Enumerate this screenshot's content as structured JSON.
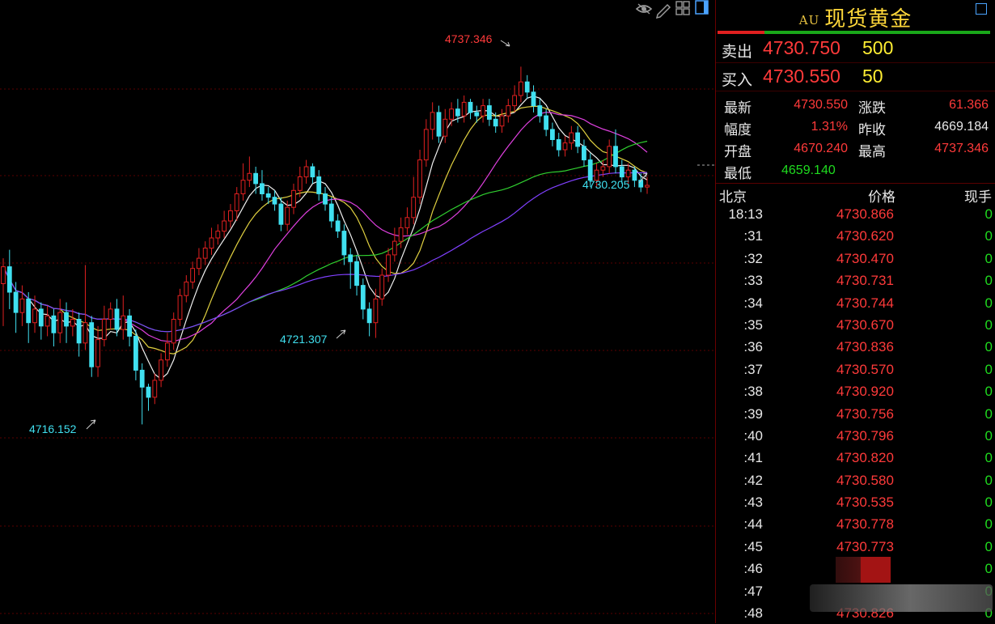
{
  "chart": {
    "toolbar_icons": [
      "eye-icon",
      "pencil-icon",
      "grid-icon",
      "panel-icon"
    ],
    "annotations": {
      "high": "4737.346",
      "low_mid": "4721.307",
      "low_left": "4716.152",
      "last": "4730.205"
    },
    "colors": {
      "up": "#e02020",
      "down": "#40e0f0",
      "ma5": "#f0f0f0",
      "ma10": "#e0d040",
      "ma20": "#e040e0",
      "ma40": "#30d030",
      "ma60": "#8040ff"
    }
  },
  "chart_data": {
    "type": "candlestick",
    "y_range": [
      4714.5,
      4739.8
    ],
    "hlines": [
      4737.346,
      4730.205,
      4716.152
    ],
    "candles": [
      [
        4724.5,
        4725.5,
        4722.0,
        4726.0
      ],
      [
        4725.5,
        4724.0,
        4723.0,
        4726.5
      ],
      [
        4724.0,
        4722.8,
        4721.6,
        4724.6
      ],
      [
        4722.8,
        4723.6,
        4722.0,
        4724.4
      ],
      [
        4723.6,
        4722.2,
        4721.0,
        4724.0
      ],
      [
        4722.2,
        4723.0,
        4721.6,
        4723.8
      ],
      [
        4723.0,
        4722.0,
        4721.2,
        4723.4
      ],
      [
        4722.0,
        4722.6,
        4721.4,
        4723.2
      ],
      [
        4722.6,
        4721.6,
        4720.8,
        4723.0
      ],
      [
        4721.6,
        4722.8,
        4721.0,
        4723.6
      ],
      [
        4722.8,
        4722.0,
        4721.0,
        4723.4
      ],
      [
        4722.0,
        4722.4,
        4721.4,
        4723.0
      ],
      [
        4722.4,
        4721.0,
        4720.2,
        4722.8
      ],
      [
        4721.0,
        4722.2,
        4720.6,
        4725.6
      ],
      [
        4722.2,
        4719.6,
        4719.0,
        4722.6
      ],
      [
        4719.6,
        4721.2,
        4719.0,
        4722.0
      ],
      [
        4721.2,
        4722.4,
        4720.8,
        4723.2
      ],
      [
        4722.4,
        4723.0,
        4721.8,
        4723.4
      ],
      [
        4723.0,
        4721.8,
        4721.4,
        4723.6
      ],
      [
        4721.8,
        4722.6,
        4721.2,
        4723.8
      ],
      [
        4722.6,
        4721.4,
        4720.8,
        4723.0
      ],
      [
        4721.4,
        4719.4,
        4718.8,
        4721.8
      ],
      [
        4719.4,
        4718.4,
        4716.2,
        4719.8
      ],
      [
        4718.4,
        4717.8,
        4717.0,
        4718.6
      ],
      [
        4717.8,
        4718.8,
        4717.4,
        4719.2
      ],
      [
        4718.8,
        4720.0,
        4718.4,
        4720.4
      ],
      [
        4720.0,
        4721.0,
        4719.6,
        4721.6
      ],
      [
        4721.0,
        4722.4,
        4720.6,
        4722.8
      ],
      [
        4722.4,
        4723.8,
        4722.0,
        4724.2
      ],
      [
        4723.8,
        4724.6,
        4723.4,
        4725.0
      ],
      [
        4724.6,
        4725.4,
        4724.2,
        4725.8
      ],
      [
        4725.4,
        4726.0,
        4725.0,
        4726.6
      ],
      [
        4726.0,
        4726.6,
        4725.6,
        4727.0
      ],
      [
        4726.6,
        4727.2,
        4726.2,
        4727.8
      ],
      [
        4727.2,
        4727.6,
        4726.8,
        4728.0
      ],
      [
        4727.6,
        4728.2,
        4727.2,
        4728.8
      ],
      [
        4728.2,
        4728.8,
        4727.8,
        4729.2
      ],
      [
        4728.8,
        4729.8,
        4728.2,
        4730.2
      ],
      [
        4729.8,
        4730.6,
        4729.4,
        4731.6
      ],
      [
        4730.6,
        4731.0,
        4730.2,
        4732.0
      ],
      [
        4731.0,
        4730.4,
        4729.8,
        4731.4
      ],
      [
        4730.4,
        4729.8,
        4729.4,
        4731.2
      ],
      [
        4729.8,
        4729.6,
        4729.2,
        4730.2
      ],
      [
        4729.6,
        4729.2,
        4728.8,
        4730.0
      ],
      [
        4729.2,
        4728.0,
        4727.6,
        4729.6
      ],
      [
        4728.0,
        4729.0,
        4727.6,
        4729.4
      ],
      [
        4729.0,
        4730.0,
        4728.6,
        4730.4
      ],
      [
        4730.0,
        4730.8,
        4729.6,
        4731.4
      ],
      [
        4730.8,
        4731.4,
        4730.4,
        4731.8
      ],
      [
        4731.4,
        4730.8,
        4730.4,
        4731.6
      ],
      [
        4730.8,
        4729.8,
        4729.4,
        4731.2
      ],
      [
        4729.8,
        4729.2,
        4728.8,
        4730.2
      ],
      [
        4729.2,
        4728.2,
        4727.8,
        4729.6
      ],
      [
        4728.2,
        4727.6,
        4727.2,
        4728.6
      ],
      [
        4727.6,
        4726.2,
        4725.6,
        4728.0
      ],
      [
        4726.2,
        4725.8,
        4724.2,
        4726.6
      ],
      [
        4725.8,
        4724.4,
        4723.8,
        4726.2
      ],
      [
        4724.4,
        4723.0,
        4722.4,
        4724.8
      ],
      [
        4723.0,
        4722.2,
        4721.4,
        4723.4
      ],
      [
        4722.2,
        4723.6,
        4721.3,
        4724.2
      ],
      [
        4723.6,
        4725.0,
        4723.2,
        4725.4
      ],
      [
        4725.0,
        4726.2,
        4724.6,
        4726.6
      ],
      [
        4726.2,
        4727.0,
        4725.8,
        4727.8
      ],
      [
        4727.0,
        4727.8,
        4726.6,
        4728.4
      ],
      [
        4727.8,
        4728.4,
        4727.4,
        4729.0
      ],
      [
        4728.4,
        4729.6,
        4728.0,
        4730.8
      ],
      [
        4729.6,
        4731.8,
        4729.2,
        4732.4
      ],
      [
        4731.8,
        4733.6,
        4731.4,
        4734.2
      ],
      [
        4733.6,
        4734.6,
        4733.0,
        4735.2
      ],
      [
        4734.6,
        4733.2,
        4732.8,
        4735.0
      ],
      [
        4733.2,
        4734.2,
        4732.8,
        4734.8
      ],
      [
        4734.2,
        4734.8,
        4733.8,
        4735.2
      ],
      [
        4734.8,
        4734.4,
        4734.0,
        4735.4
      ],
      [
        4734.4,
        4735.2,
        4734.0,
        4735.6
      ],
      [
        4735.2,
        4734.6,
        4734.2,
        4735.4
      ],
      [
        4734.6,
        4734.4,
        4734.0,
        4735.0
      ],
      [
        4734.4,
        4735.0,
        4734.0,
        4735.4
      ],
      [
        4735.0,
        4734.2,
        4733.8,
        4735.4
      ],
      [
        4734.2,
        4733.8,
        4733.4,
        4734.6
      ],
      [
        4733.8,
        4734.4,
        4733.4,
        4734.8
      ],
      [
        4734.4,
        4735.0,
        4734.0,
        4735.4
      ],
      [
        4735.0,
        4735.6,
        4734.6,
        4736.2
      ],
      [
        4735.6,
        4736.4,
        4735.2,
        4737.3
      ],
      [
        4736.4,
        4735.8,
        4735.4,
        4736.8
      ],
      [
        4735.8,
        4735.0,
        4734.6,
        4736.2
      ],
      [
        4735.0,
        4734.4,
        4734.0,
        4735.4
      ],
      [
        4734.4,
        4733.6,
        4733.2,
        4734.8
      ],
      [
        4733.6,
        4733.0,
        4732.6,
        4734.0
      ],
      [
        4733.0,
        4732.4,
        4732.0,
        4733.4
      ],
      [
        4732.4,
        4732.8,
        4732.0,
        4733.2
      ],
      [
        4732.8,
        4733.4,
        4732.4,
        4733.8
      ],
      [
        4733.4,
        4732.6,
        4732.2,
        4733.8
      ],
      [
        4732.6,
        4731.8,
        4731.4,
        4733.0
      ],
      [
        4731.8,
        4730.6,
        4730.2,
        4732.2
      ],
      [
        4730.6,
        4731.2,
        4730.2,
        4731.6
      ],
      [
        4731.2,
        4731.4,
        4730.8,
        4731.8
      ],
      [
        4731.4,
        4732.6,
        4731.0,
        4733.0
      ],
      [
        4732.6,
        4731.4,
        4731.0,
        4733.6
      ],
      [
        4731.4,
        4730.8,
        4730.4,
        4731.8
      ],
      [
        4730.8,
        4731.2,
        4730.4,
        4731.6
      ],
      [
        4731.2,
        4730.6,
        4730.2,
        4731.4
      ],
      [
        4730.6,
        4730.2,
        4729.9,
        4731.0
      ],
      [
        4730.2,
        4730.3,
        4729.8,
        4730.8
      ]
    ]
  },
  "panel": {
    "symbol": "AU",
    "title": "现货黄金",
    "sell_label": "卖出",
    "sell_price": "4730.750",
    "sell_vol": "500",
    "buy_label": "买入",
    "buy_price": "4730.550",
    "buy_vol": "50",
    "stats": {
      "latest_label": "最新",
      "latest": "4730.550",
      "change_label": "涨跌",
      "change": "61.366",
      "range_label": "幅度",
      "range": "1.31%",
      "prev_label": "昨收",
      "prev": "4669.184",
      "open_label": "开盘",
      "open": "4670.240",
      "high_label": "最高",
      "high": "4737.346",
      "low_label": "最低",
      "low": "4659.140"
    },
    "ticks_header": {
      "time": "北京",
      "price": "价格",
      "qty": "现手"
    },
    "ticks": [
      {
        "t": "18:13",
        "p": "4730.866",
        "q": "0"
      },
      {
        "t": ":31",
        "p": "4730.620",
        "q": "0"
      },
      {
        "t": ":32",
        "p": "4730.470",
        "q": "0"
      },
      {
        "t": ":33",
        "p": "4730.731",
        "q": "0"
      },
      {
        "t": ":34",
        "p": "4730.744",
        "q": "0"
      },
      {
        "t": ":35",
        "p": "4730.670",
        "q": "0"
      },
      {
        "t": ":36",
        "p": "4730.836",
        "q": "0"
      },
      {
        "t": ":37",
        "p": "4730.570",
        "q": "0"
      },
      {
        "t": ":38",
        "p": "4730.920",
        "q": "0"
      },
      {
        "t": ":39",
        "p": "4730.756",
        "q": "0"
      },
      {
        "t": ":40",
        "p": "4730.796",
        "q": "0"
      },
      {
        "t": ":41",
        "p": "4730.820",
        "q": "0"
      },
      {
        "t": ":42",
        "p": "4730.580",
        "q": "0"
      },
      {
        "t": ":43",
        "p": "4730.535",
        "q": "0"
      },
      {
        "t": ":44",
        "p": "4730.778",
        "q": "0"
      },
      {
        "t": ":45",
        "p": "4730.773",
        "q": "0"
      },
      {
        "t": ":46",
        "p": "",
        "q": "0"
      },
      {
        "t": ":47",
        "p": "",
        "q": "0"
      },
      {
        "t": ":48",
        "p": "4730.826",
        "q": "0"
      }
    ]
  }
}
